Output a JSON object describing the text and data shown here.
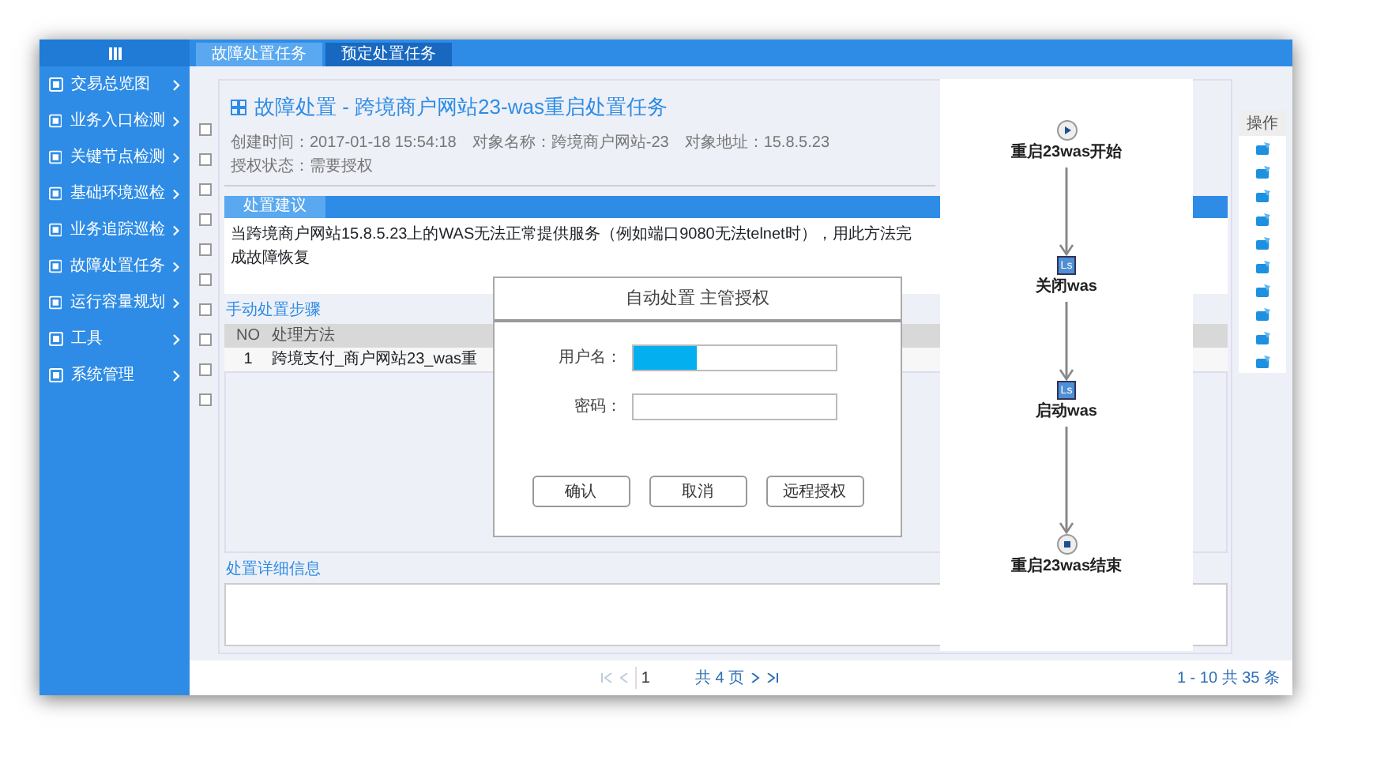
{
  "sidebar": {
    "items": [
      {
        "label": "交易总览图"
      },
      {
        "label": "业务入口检测"
      },
      {
        "label": "关键节点检测"
      },
      {
        "label": "基础环境巡检"
      },
      {
        "label": "业务追踪巡检"
      },
      {
        "label": "故障处置任务"
      },
      {
        "label": "运行容量规划"
      },
      {
        "label": "工具"
      },
      {
        "label": "系统管理"
      }
    ]
  },
  "tabs": [
    {
      "label": "故障处置任务",
      "selected": true
    },
    {
      "label": "预定处置任务",
      "selected": false
    }
  ],
  "row_checkboxes": [
    {
      "checked": false
    },
    {
      "checked": false
    },
    {
      "checked": false
    },
    {
      "checked": false
    },
    {
      "checked": false
    },
    {
      "checked": false
    },
    {
      "checked": false
    },
    {
      "checked": false
    },
    {
      "checked": false
    },
    {
      "checked": false
    }
  ],
  "task": {
    "title": "故障处置 - 跨境商户网站23-was重启处置任务",
    "meta": [
      "创建时间：2017-01-18 15:54:18",
      "对象名称：跨境商户网站-23",
      "对象地址：15.8.5.23",
      "授权状态：需要授权"
    ],
    "subtab": "处置建议",
    "description": "当跨境商户网站15.8.5.23上的WAS无法正常提供服务（例如端口9080无法telnet时），用此方法完成故障恢复",
    "steps_heading": "手动处置步骤",
    "steps_table": {
      "columns": [
        "NO",
        "处理方法"
      ],
      "rows": [
        [
          "1",
          "跨境支付_商户网站23_was重"
        ]
      ]
    },
    "detail_heading": "处置详细信息"
  },
  "actions_column": {
    "heading": "操作",
    "rows": [
      {
        "kind": "edit"
      },
      {
        "kind": "edit"
      },
      {
        "kind": "edit"
      },
      {
        "kind": "edit"
      },
      {
        "kind": "edit"
      },
      {
        "kind": "edit"
      },
      {
        "kind": "edit"
      },
      {
        "kind": "edit"
      },
      {
        "kind": "edit"
      },
      {
        "kind": "edit"
      }
    ]
  },
  "flow": {
    "nodes": [
      {
        "kind": "start",
        "label": "重启23was开始"
      },
      {
        "kind": "task",
        "badge": "Ls",
        "label": "关闭was"
      },
      {
        "kind": "task",
        "badge": "Ls",
        "label": "启动was"
      },
      {
        "kind": "end",
        "label": "重启23was结束"
      }
    ]
  },
  "dialog": {
    "title": "自动处置 主管授权",
    "fields": [
      {
        "label": "用户名：",
        "highlighted": true
      },
      {
        "label": "密码：",
        "highlighted": false
      }
    ],
    "buttons": [
      "确认",
      "取消",
      "远程授权"
    ]
  },
  "pagination": {
    "page": "1",
    "pages_label": "共 4 页",
    "range": "1 - 10  共 35 条"
  }
}
